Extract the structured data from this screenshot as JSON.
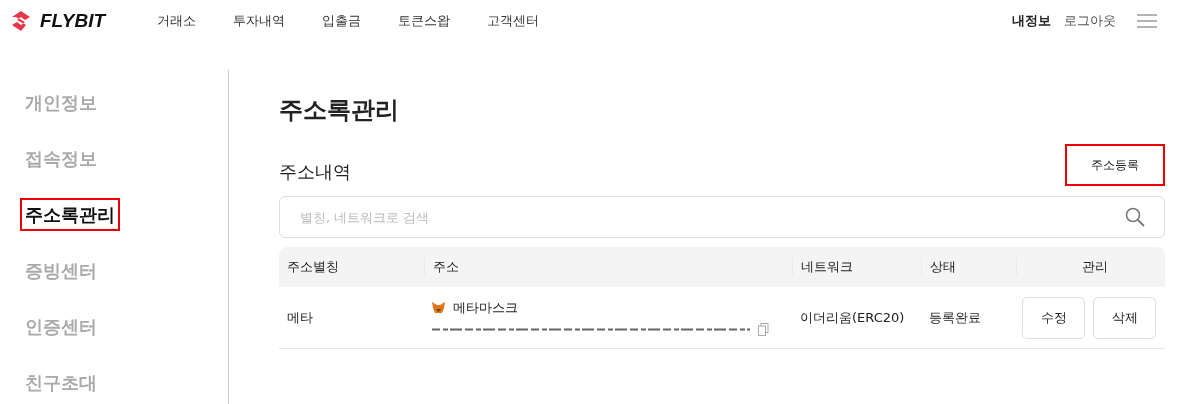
{
  "header": {
    "logo": "FLYBIT",
    "nav": [
      {
        "label": "거래소"
      },
      {
        "label": "투자내역"
      },
      {
        "label": "입출금"
      },
      {
        "label": "토큰스왑"
      },
      {
        "label": "고객센터"
      }
    ],
    "my_info": "내정보",
    "logout": "로그아웃"
  },
  "sidebar": {
    "items": [
      {
        "label": "개인정보",
        "selected": false,
        "highlighted": false
      },
      {
        "label": "접속정보",
        "selected": false,
        "highlighted": false
      },
      {
        "label": "주소록관리",
        "selected": true,
        "highlighted": true
      },
      {
        "label": "증빙센터",
        "selected": false,
        "highlighted": false
      },
      {
        "label": "인증센터",
        "selected": false,
        "highlighted": false
      },
      {
        "label": "친구초대",
        "selected": false,
        "highlighted": false
      }
    ]
  },
  "page_title": "주소록관리",
  "section_title": "주소내역",
  "register_button": {
    "label": "주소등록",
    "highlighted": true
  },
  "search": {
    "placeholder": "별칭, 네트워크로 검색"
  },
  "table": {
    "columns": [
      "주소별칭",
      "주소",
      "네트워크",
      "상태",
      "관리"
    ],
    "rows": [
      {
        "alias": "메타",
        "wallet": "메타마스크",
        "network": "이더리움(ERC20)",
        "status": "등록완료",
        "actions": [
          "수정",
          "삭제"
        ]
      }
    ]
  }
}
